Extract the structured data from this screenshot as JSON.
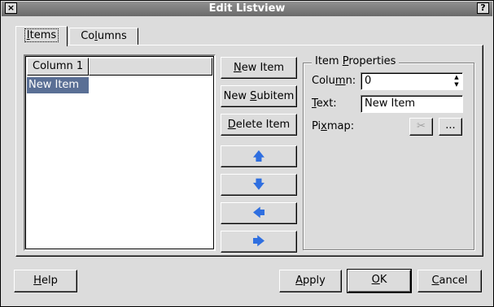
{
  "window": {
    "title": "Edit Listview",
    "close_glyph": "×",
    "help_glyph": "?"
  },
  "tabs": [
    {
      "label_before": "",
      "mnemonic": "I",
      "label_after": "tems"
    },
    {
      "label_before": "Co",
      "mnemonic": "l",
      "label_after": "umns"
    }
  ],
  "listview": {
    "column_header": "Column 1",
    "items": [
      "New Item"
    ]
  },
  "item_buttons": {
    "new_item": {
      "before": "",
      "mnemonic": "N",
      "after": "ew Item"
    },
    "new_subitem": {
      "before": "New ",
      "mnemonic": "S",
      "after": "ubitem"
    },
    "delete_item": {
      "before": "",
      "mnemonic": "D",
      "after": "elete Item"
    },
    "move_up_glyph": "🡅",
    "move_down_glyph": "🡇",
    "move_left_glyph": "🡄",
    "move_right_glyph": "🡆"
  },
  "properties": {
    "group_title_before": "Item ",
    "group_title_mnemonic": "P",
    "group_title_after": "roperties",
    "column_label_before": "Colu",
    "column_label_mnemonic": "m",
    "column_label_after": "n:",
    "column_value": "0",
    "text_label_mnemonic": "T",
    "text_label_after": "ext:",
    "text_value": "New Item",
    "pixmap_label_before": "Pi",
    "pixmap_label_mnemonic": "x",
    "pixmap_label_after": "map:",
    "pixmap_clear_glyph": "✂",
    "pixmap_browse_label": "..."
  },
  "footer": {
    "help": {
      "mnemonic": "H",
      "after": "elp"
    },
    "apply": {
      "mnemonic": "A",
      "after": "pply"
    },
    "ok": {
      "mnemonic": "O",
      "after": "K"
    },
    "cancel": {
      "mnemonic": "C",
      "after": "ancel"
    }
  },
  "colors": {
    "selection": "#5a6f95",
    "arrow": "#2f6fe0",
    "titlebar": "#7a7a7a"
  }
}
